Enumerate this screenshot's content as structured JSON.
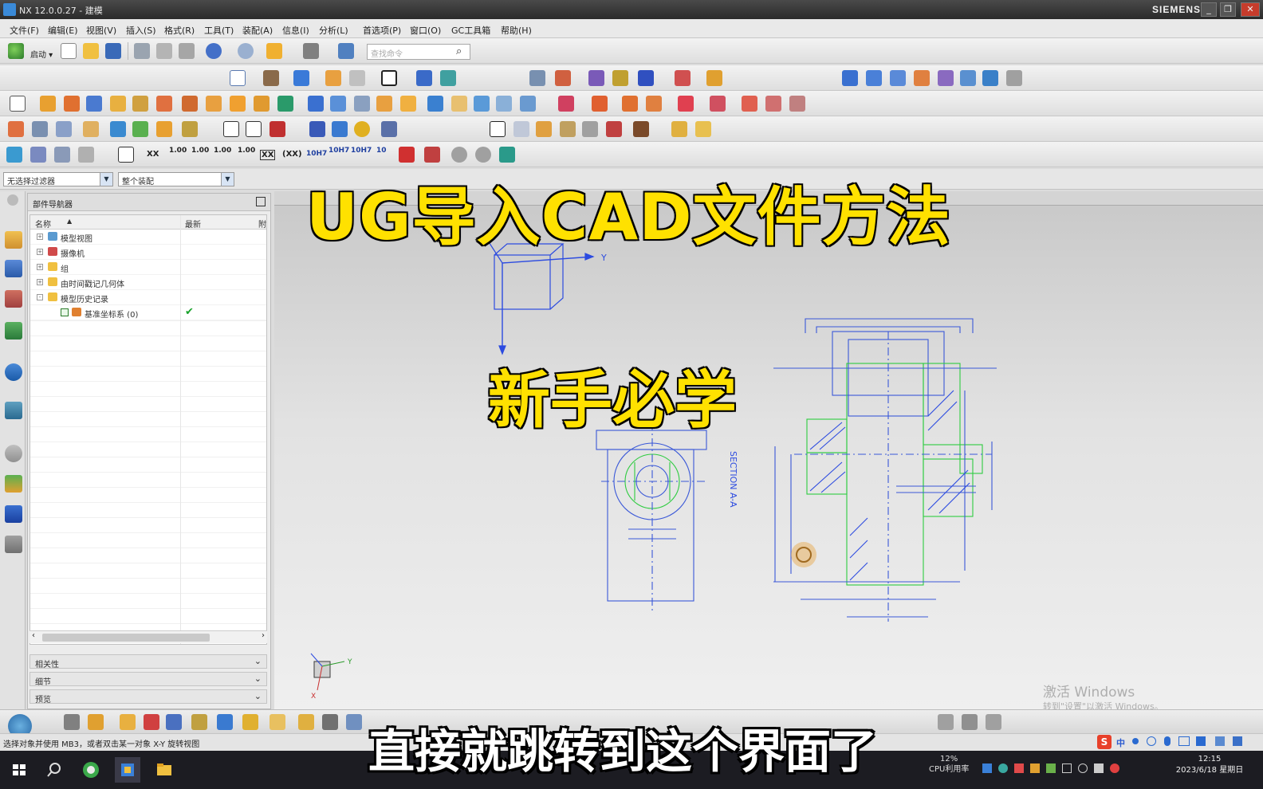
{
  "window": {
    "title": "NX 12.0.0.27 - 建模",
    "brand": "SIEMENS",
    "min_label": "_",
    "restore_label": "❐",
    "close_label": "✕"
  },
  "menu": [
    "文件(F)",
    "编辑(E)",
    "视图(V)",
    "插入(S)",
    "格式(R)",
    "工具(T)",
    "装配(A)",
    "信息(I)",
    "分析(L)",
    "首选项(P)",
    "窗口(O)",
    "GC工具箱",
    "帮助(H)"
  ],
  "toolbar": {
    "launch_label": "启动 ▾",
    "search_placeholder": "查找命令",
    "text_buttons": [
      "XX",
      "1.00",
      "1.00",
      "1.00",
      "1.00",
      "XX",
      "(XX)",
      "10H7",
      "10H7",
      "10H7",
      "10"
    ]
  },
  "selection_bar": {
    "filter_value": "无选择过滤器",
    "scope_value": "整个装配"
  },
  "navigator": {
    "title": "部件导航器",
    "columns": [
      "名称",
      "最新",
      "附"
    ],
    "rows": [
      {
        "label": "模型视图",
        "level": 1,
        "expander": "+",
        "icon": "views-icon",
        "check": ""
      },
      {
        "label": "摄像机",
        "level": 1,
        "expander": "+",
        "icon": "camera-icon",
        "check": ""
      },
      {
        "label": "组",
        "level": 1,
        "expander": "+",
        "icon": "folder-icon",
        "check": ""
      },
      {
        "label": "由时间戳记几何体",
        "level": 1,
        "expander": "+",
        "icon": "folder-icon",
        "check": ""
      },
      {
        "label": "模型历史记录",
        "level": 1,
        "expander": "-",
        "icon": "folder-icon",
        "check": ""
      },
      {
        "label": "基准坐标系 (0)",
        "level": 2,
        "expander": "",
        "icon": "datum-csys-icon",
        "check": "✔"
      }
    ],
    "panels": [
      "相关性",
      "细节",
      "预览"
    ]
  },
  "statusbar": {
    "text": "选择对象并使用 MB3，或者双击某一对象 X-Y 旋转视图"
  },
  "watermark": {
    "line1": "激活 Windows",
    "line2": "转到\"设置\"以激活 Windows。"
  },
  "drawing": {
    "section_label": "SECTION A-A",
    "axis_y": "Y",
    "axis_x": "X",
    "triad_y": "Y"
  },
  "taskbar": {
    "cpu_percent": "12%",
    "cpu_label": "CPU利用率",
    "time": "12:15",
    "date": "2023/6/18 星期日"
  },
  "ime": {
    "label": "中"
  },
  "overlay": {
    "title": "UG导入CAD文件方法",
    "subtitle": "新手必学",
    "caption": "直接就跳转到这个界面了"
  },
  "colors": {
    "overlay_yellow": "#ffe100",
    "sketch_green": "#2ecc40",
    "sketch_blue": "#2c4be0"
  }
}
